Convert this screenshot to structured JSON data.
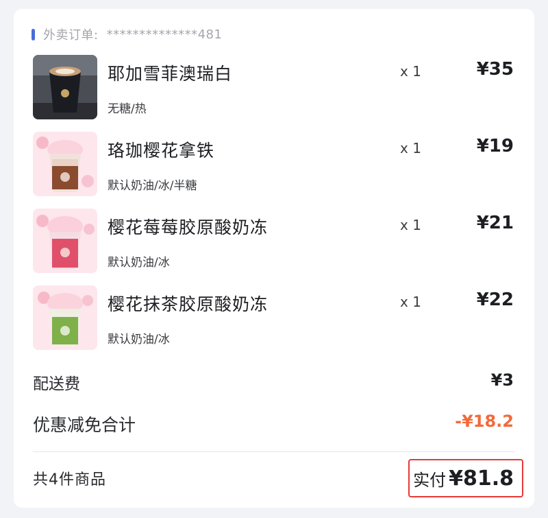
{
  "order": {
    "label": "外卖订单:",
    "number": "**************481"
  },
  "items": [
    {
      "name": "耶加雪菲澳瑞白",
      "spec": "无糖/热",
      "qty": "x 1",
      "price": "¥35"
    },
    {
      "name": "珞珈樱花拿铁",
      "spec": "默认奶油/冰/半糖",
      "qty": "x 1",
      "price": "¥19"
    },
    {
      "name": "樱花莓莓胶原酸奶冻",
      "spec": "默认奶油/冰",
      "qty": "x 1",
      "price": "¥21"
    },
    {
      "name": "樱花抹茶胶原酸奶冻",
      "spec": "默认奶油/冰",
      "qty": "x 1",
      "price": "¥22"
    }
  ],
  "delivery": {
    "label": "配送费",
    "value": "¥3"
  },
  "discount": {
    "label": "优惠减免合计",
    "value": "-¥18.2"
  },
  "summary": {
    "count_text": "共4件商品",
    "paid_label": "实付",
    "paid_value": "¥81.8"
  },
  "colors": {
    "accent": "#4a6cdb",
    "discount": "#f26a3a",
    "highlight_border": "#e53935"
  }
}
